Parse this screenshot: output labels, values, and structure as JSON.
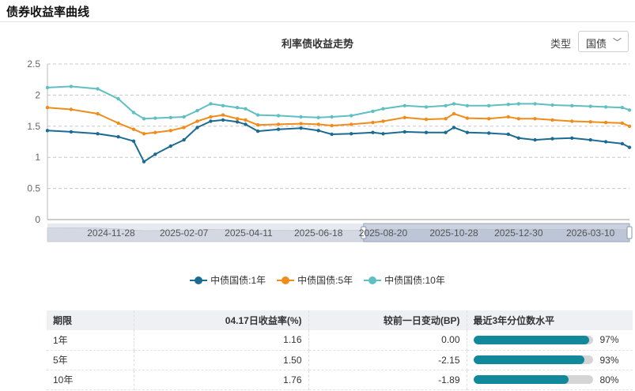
{
  "panel": {
    "title": "债券收益率曲线"
  },
  "controls": {
    "type_label": "类型",
    "type_value": "国债"
  },
  "chart_data": {
    "type": "line",
    "title": "利率债收益走势",
    "ylim": [
      0,
      2.5
    ],
    "yticks": [
      "0",
      "0.5",
      "1",
      "1.5",
      "2",
      "2.5"
    ],
    "grid": true,
    "legend_position": "bottom-center",
    "x_range": [
      "2024-09-27",
      "2026-04-17"
    ],
    "xticks": [
      "2024-11-28",
      "2025-02-07",
      "2025-04-11",
      "2025-06-18",
      "2025-08-20",
      "2025-10-28",
      "2025-12-30",
      "2026-03-10"
    ],
    "zoom_window": [
      "2025-08-01",
      "2026-04-17"
    ],
    "series": [
      {
        "name": "中债国债:1年",
        "color": "#1c6b93",
        "x": [
          "2024-09-27",
          "2024-10-20",
          "2024-11-15",
          "2024-12-05",
          "2024-12-20",
          "2024-12-30",
          "2025-01-10",
          "2025-01-25",
          "2025-02-07",
          "2025-02-20",
          "2025-03-05",
          "2025-03-17",
          "2025-03-31",
          "2025-04-08",
          "2025-04-20",
          "2025-05-10",
          "2025-06-01",
          "2025-06-18",
          "2025-07-01",
          "2025-07-20",
          "2025-08-10",
          "2025-08-20",
          "2025-09-10",
          "2025-10-01",
          "2025-10-20",
          "2025-10-28",
          "2025-11-10",
          "2025-12-01",
          "2025-12-20",
          "2025-12-30",
          "2026-01-15",
          "2026-02-01",
          "2026-02-20",
          "2026-03-10",
          "2026-03-25",
          "2026-04-10",
          "2026-04-17"
        ],
        "y": [
          1.43,
          1.41,
          1.38,
          1.33,
          1.26,
          0.93,
          1.05,
          1.18,
          1.28,
          1.48,
          1.58,
          1.6,
          1.57,
          1.53,
          1.42,
          1.45,
          1.47,
          1.43,
          1.37,
          1.38,
          1.4,
          1.38,
          1.41,
          1.4,
          1.4,
          1.48,
          1.4,
          1.39,
          1.37,
          1.31,
          1.28,
          1.3,
          1.31,
          1.28,
          1.25,
          1.22,
          1.16
        ]
      },
      {
        "name": "中债国债:5年",
        "color": "#f08c1a",
        "x": [
          "2024-09-27",
          "2024-10-20",
          "2024-11-15",
          "2024-12-05",
          "2024-12-20",
          "2024-12-30",
          "2025-01-10",
          "2025-01-25",
          "2025-02-07",
          "2025-02-20",
          "2025-03-05",
          "2025-03-17",
          "2025-03-31",
          "2025-04-08",
          "2025-04-20",
          "2025-05-10",
          "2025-06-01",
          "2025-06-18",
          "2025-07-01",
          "2025-07-20",
          "2025-08-10",
          "2025-08-20",
          "2025-09-10",
          "2025-10-01",
          "2025-10-20",
          "2025-10-28",
          "2025-11-10",
          "2025-12-01",
          "2025-12-20",
          "2025-12-30",
          "2026-01-15",
          "2026-02-01",
          "2026-02-20",
          "2026-03-10",
          "2026-03-25",
          "2026-04-10",
          "2026-04-17"
        ],
        "y": [
          1.8,
          1.77,
          1.7,
          1.55,
          1.45,
          1.38,
          1.4,
          1.43,
          1.48,
          1.58,
          1.65,
          1.68,
          1.62,
          1.6,
          1.52,
          1.53,
          1.54,
          1.53,
          1.51,
          1.53,
          1.56,
          1.58,
          1.64,
          1.61,
          1.62,
          1.7,
          1.63,
          1.62,
          1.65,
          1.62,
          1.62,
          1.6,
          1.58,
          1.57,
          1.56,
          1.55,
          1.5
        ]
      },
      {
        "name": "中债国债:10年",
        "color": "#5fbfc3",
        "x": [
          "2024-09-27",
          "2024-10-20",
          "2024-11-15",
          "2024-12-05",
          "2024-12-20",
          "2024-12-30",
          "2025-01-10",
          "2025-01-25",
          "2025-02-07",
          "2025-02-20",
          "2025-03-05",
          "2025-03-17",
          "2025-03-31",
          "2025-04-08",
          "2025-04-20",
          "2025-05-10",
          "2025-06-01",
          "2025-06-18",
          "2025-07-01",
          "2025-07-20",
          "2025-08-10",
          "2025-08-20",
          "2025-09-10",
          "2025-10-01",
          "2025-10-20",
          "2025-10-28",
          "2025-11-10",
          "2025-12-01",
          "2025-12-20",
          "2025-12-30",
          "2026-01-15",
          "2026-02-01",
          "2026-02-20",
          "2026-03-10",
          "2026-03-25",
          "2026-04-10",
          "2026-04-17"
        ],
        "y": [
          2.12,
          2.14,
          2.1,
          1.94,
          1.72,
          1.62,
          1.63,
          1.64,
          1.65,
          1.75,
          1.86,
          1.83,
          1.8,
          1.78,
          1.68,
          1.67,
          1.65,
          1.64,
          1.65,
          1.67,
          1.74,
          1.78,
          1.83,
          1.81,
          1.83,
          1.86,
          1.83,
          1.83,
          1.85,
          1.86,
          1.86,
          1.84,
          1.83,
          1.82,
          1.81,
          1.8,
          1.76
        ]
      }
    ]
  },
  "table": {
    "headers": [
      "期限",
      "04.17日收益率(%)",
      "较前一日变动(BP)",
      "最近3年分位数水平"
    ],
    "rows": [
      {
        "term": "1年",
        "yield": "1.16",
        "change": "0.00",
        "pct_text": "97%",
        "pct": 0.97
      },
      {
        "term": "5年",
        "yield": "1.50",
        "change": "-2.15",
        "pct_text": "93%",
        "pct": 0.93
      },
      {
        "term": "10年",
        "yield": "1.76",
        "change": "-1.89",
        "pct_text": "80%",
        "pct": 0.8
      }
    ]
  }
}
